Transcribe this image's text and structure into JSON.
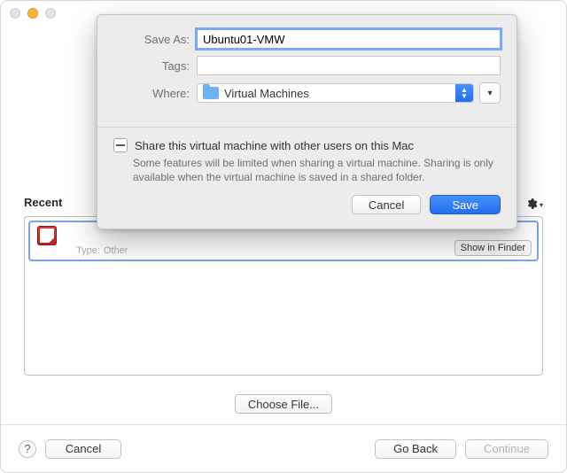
{
  "titlebar": {},
  "sheet": {
    "save_as_label": "Save As:",
    "save_as_value": "Ubuntu01-VMW",
    "tags_label": "Tags:",
    "tags_value": "",
    "where_label": "Where:",
    "where_value": "Virtual Machines",
    "share_title": "Share this virtual machine with other users on this Mac",
    "share_desc": "Some features will be limited when sharing a virtual machine. Sharing is only available when the virtual machine is saved in a shared folder.",
    "cancel_label": "Cancel",
    "save_label": "Save"
  },
  "back": {
    "recent_label": "Recent",
    "row_type_label": "Type:",
    "row_type_value": "Other",
    "show_in_finder": "Show in Finder",
    "choose_file": "Choose File..."
  },
  "bottom": {
    "help": "?",
    "cancel": "Cancel",
    "go_back": "Go Back",
    "continue": "Continue"
  }
}
